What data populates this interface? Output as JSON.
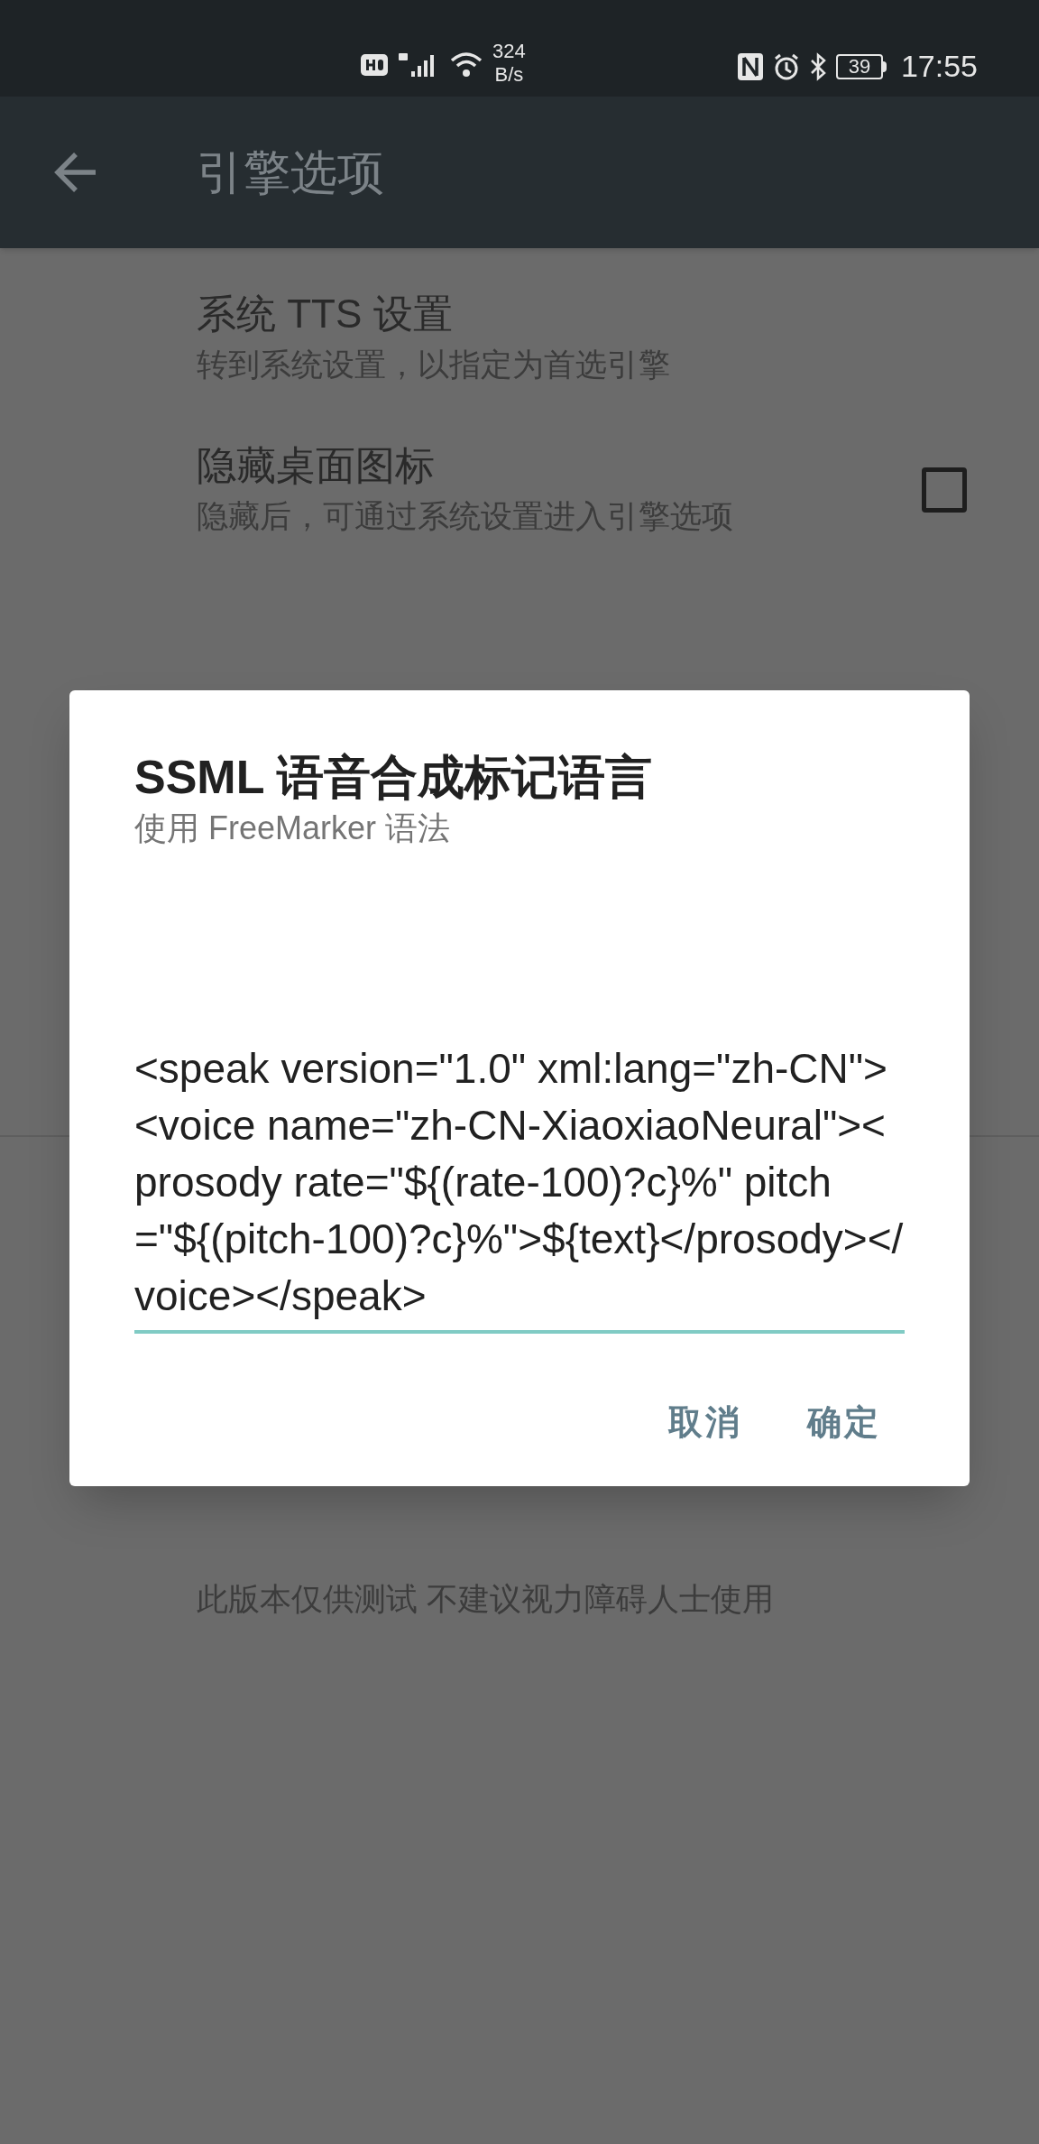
{
  "status_bar": {
    "network_speed": "324",
    "network_unit": "B/s",
    "battery": "39",
    "time": "17:55"
  },
  "toolbar": {
    "title": "引擎选项"
  },
  "settings": [
    {
      "kind": "link",
      "title": "系统 TTS 设置",
      "summary": "转到系统设置，以指定为首选引擎"
    },
    {
      "kind": "checkbox",
      "title": "隐藏桌面图标",
      "summary": "隐藏后，可通过系统设置进入引擎选项",
      "checked": false
    }
  ],
  "note": {
    "summary": "此版本仅供测试 不建议视力障碍人士使用"
  },
  "dialog": {
    "title": "SSML 语音合成标记语言",
    "subtitle": "使用 FreeMarker 语法",
    "value": "<speak version=\"1.0\" xml:lang=\"zh-CN\"><voice name=\"zh-CN-XiaoxiaoNeural\"><prosody rate=\"${(rate-100)?c}%\" pitch=\"${(pitch-100)?c}%\">${text}</prosody></voice></speak>",
    "buttons": [
      "取消",
      "确定"
    ]
  }
}
